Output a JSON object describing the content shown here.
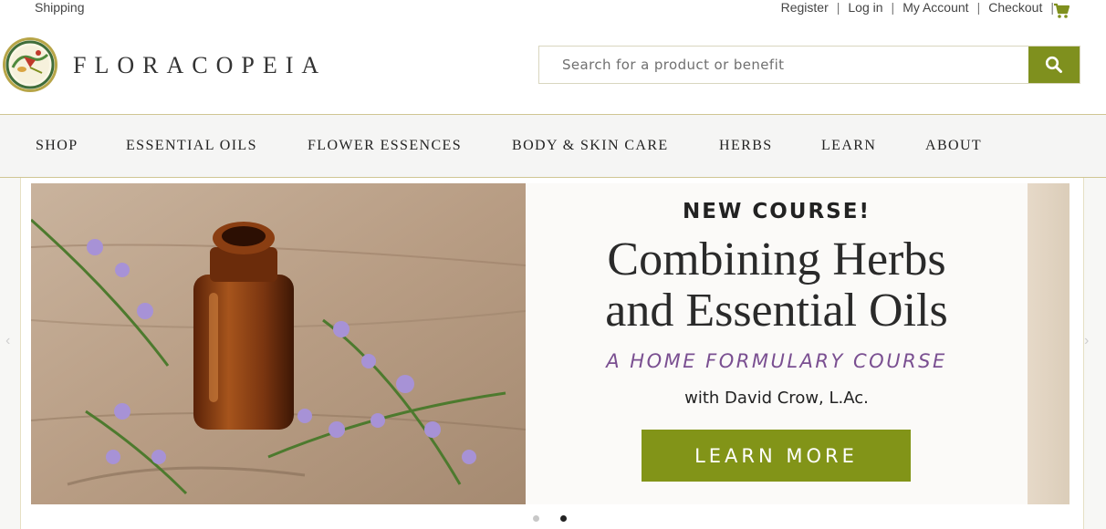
{
  "topbar": {
    "shipping": "Shipping",
    "links": [
      "Register",
      "Log in",
      "My Account",
      "Checkout"
    ],
    "separator": "|",
    "cart_icon": "shopping-cart-icon"
  },
  "header": {
    "brand": "FLORACOPEIA",
    "logo_icon": "hummingbird-logo",
    "search": {
      "placeholder": "Search for a product or benefit",
      "value": ""
    },
    "search_icon": "search-icon"
  },
  "nav": {
    "items": [
      "SHOP",
      "ESSENTIAL OILS",
      "FLOWER ESSENCES",
      "BODY & SKIN CARE",
      "HERBS",
      "LEARN",
      "ABOUT"
    ]
  },
  "slide": {
    "kicker": "NEW COURSE!",
    "headline_line1": "Combining Herbs",
    "headline_line2": "and Essential Oils",
    "subline": "A HOME FORMULARY COURSE",
    "byline": "with David Crow, L.Ac.",
    "cta": "LEARN MORE"
  },
  "slider": {
    "total": 2,
    "active": 2
  },
  "colors": {
    "accent": "#7f901e",
    "cta": "#829418",
    "subline": "#7a4f91",
    "border": "#d0c693"
  }
}
